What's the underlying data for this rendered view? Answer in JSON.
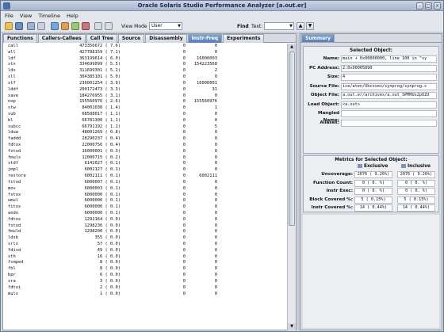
{
  "window": {
    "title": "Oracle Solaris Studio Performance Analyzer [a.out.er]"
  },
  "menu": [
    "File",
    "View",
    "Timeline",
    "Help"
  ],
  "toolbar": {
    "view_mode_label": "View Mode",
    "view_mode_value": "User",
    "find_label": "Find",
    "find_text_label": "Text:"
  },
  "tabs": [
    "Functions",
    "Callers-Callees",
    "Call Tree",
    "Source",
    "Disassembly",
    "Instr-Freq",
    "Experiments"
  ],
  "active_tab": "Instr-Freq",
  "instr_freq": [
    {
      "name": "call",
      "freq": "473356672 (  7.6)",
      "a": "0",
      "b": "0"
    },
    {
      "name": "all",
      "freq": "427788159 (  7.1)",
      "a": "0",
      "b": "0"
    },
    {
      "name": "ldf",
      "freq": "363199614 (  6.0)",
      "a": "0",
      "b": "16000003"
    },
    {
      "name": "stx",
      "freq": "334699099 (  5.5)",
      "a": "0",
      "b": "154223568"
    },
    {
      "name": "ldx",
      "freq": "311699301 (  5.2)",
      "a": "0",
      "b": "2"
    },
    {
      "name": "sll",
      "freq": "304385101 (  5.0)",
      "a": "0",
      "b": "0"
    },
    {
      "name": "stf",
      "freq": "236001254 (  3.9)",
      "a": "0",
      "b": "16000001"
    },
    {
      "name": "lddf",
      "freq": "200172473 (  3.3)",
      "a": "0",
      "b": "31"
    },
    {
      "name": "save",
      "freq": "184276955 (  3.1)",
      "a": "0",
      "b": "0"
    },
    {
      "name": "nop",
      "freq": "155560976 (  2.6)",
      "a": "0",
      "b": "155560976"
    },
    {
      "name": "stw",
      "freq": "84001030 (  1.4)",
      "a": "0",
      "b": "1"
    },
    {
      "name": "sub",
      "freq": "68588017 (  1.1)",
      "a": "0",
      "b": "0"
    },
    {
      "name": "bl",
      "freq": "66781300 (  1.1)",
      "a": "0",
      "b": "0"
    },
    {
      "name": "subcc",
      "freq": "66791192 (  1.1)",
      "a": "0",
      "b": "5"
    },
    {
      "name": "lduw",
      "freq": "48001269 (  0.8)",
      "a": "0",
      "b": "0"
    },
    {
      "name": "faddd",
      "freq": "28290237 (  0.4)",
      "a": "0",
      "b": "0"
    },
    {
      "name": "fdtox",
      "freq": "22000756 (  0.4)",
      "a": "0",
      "b": "0"
    },
    {
      "name": "fxtod",
      "freq": "16000001 (  0.3)",
      "a": "0",
      "b": "0"
    },
    {
      "name": "fmuls",
      "freq": "12000715 (  0.2)",
      "a": "0",
      "b": "0"
    },
    {
      "name": "stdf",
      "freq": "6142027 (  0.1)",
      "a": "0",
      "b": "0"
    },
    {
      "name": "jmpl",
      "freq": "6002127 (  0.1)",
      "a": "0",
      "b": "0"
    },
    {
      "name": "restore",
      "freq": "6002111 (  0.1)",
      "a": "0",
      "b": "6002111"
    },
    {
      "name": "fitod",
      "freq": "6000007 (  0.1)",
      "a": "0",
      "b": "0"
    },
    {
      "name": "mov",
      "freq": "6000003 (  0.1)",
      "a": "0",
      "b": "0"
    },
    {
      "name": "fstox",
      "freq": "6000000 (  0.1)",
      "a": "0",
      "b": "0"
    },
    {
      "name": "umul",
      "freq": "6000000 (  0.1)",
      "a": "0",
      "b": "0"
    },
    {
      "name": "fitos",
      "freq": "6000000 (  0.1)",
      "a": "0",
      "b": "0"
    },
    {
      "name": "andn",
      "freq": "6000000 (  0.1)",
      "a": "0",
      "b": "0"
    },
    {
      "name": "fdtos",
      "freq": "1292164 (  0.0)",
      "a": "0",
      "b": "0"
    },
    {
      "name": "fstod",
      "freq": "1298236 (  0.0)",
      "a": "0",
      "b": "0"
    },
    {
      "name": "fmuld",
      "freq": "1298200 (  0.0)",
      "a": "0",
      "b": "0"
    },
    {
      "name": "ldsb",
      "freq": "355 (  0.0)",
      "a": "0",
      "b": "0"
    },
    {
      "name": "srlx",
      "freq": "57 (  0.0)",
      "a": "0",
      "b": "0"
    },
    {
      "name": "fdivd",
      "freq": "49 (  0.0)",
      "a": "0",
      "b": "0"
    },
    {
      "name": "sth",
      "freq": "16 (  0.0)",
      "a": "0",
      "b": "0"
    },
    {
      "name": "fcmped",
      "freq": "8 (  0.0)",
      "a": "0",
      "b": "0"
    },
    {
      "name": "fbl",
      "freq": "8 (  0.0)",
      "a": "0",
      "b": "0"
    },
    {
      "name": "bpr",
      "freq": "6 (  0.0)",
      "a": "0",
      "b": "0"
    },
    {
      "name": "sra",
      "freq": "3 (  0.0)",
      "a": "0",
      "b": "0"
    },
    {
      "name": "fdtoi",
      "freq": "2 (  0.0)",
      "a": "0",
      "b": "0"
    },
    {
      "name": "mulx",
      "freq": "1 (  0.0)",
      "a": "0",
      "b": "0"
    }
  ],
  "summary": {
    "tab_label": "Summary",
    "selected_title": "Selected Object:",
    "fields": [
      {
        "label": "Name:",
        "value": "main + 0x00000000, line 100 in \"sy"
      },
      {
        "label": "PC Address:",
        "value": "2:0x00005890"
      },
      {
        "label": "Size:",
        "value": "4"
      },
      {
        "label": "Source File:",
        "value": "ice/aten/Ubcovex/synprog/synprog.c"
      },
      {
        "label": "Object File:",
        "value": "a.out.er/archives/a.out_SPMHUs2pUZd"
      },
      {
        "label": "Load Object:",
        "value": "<a.out>"
      },
      {
        "label": "Mangled Name:",
        "value": ""
      },
      {
        "label": "Aliases:",
        "value": ""
      }
    ],
    "metrics_title": "Metrics for Selected Object:",
    "exclusive_label": "Exclusive",
    "inclusive_label": "Inclusive",
    "metrics": [
      {
        "label": "Uncoverage:",
        "ex": "2076 (  9.26%)",
        "in": "2076 (  9.26%)"
      },
      {
        "label": "Function Count:",
        "ex": "0 (  0.   %)",
        "in": "0 (  0.   %)"
      },
      {
        "label": "Instr Exec:",
        "ex": "0 (  0.   %)",
        "in": "0 (  0.   %)"
      },
      {
        "label": "Block Covered %:",
        "ex": "5 (  0.15%)",
        "in": "5 (  0.15%)"
      },
      {
        "label": "Instr Covered %:",
        "ex": "14 (  0.44%)",
        "in": "14 (  0.44%)"
      }
    ]
  }
}
